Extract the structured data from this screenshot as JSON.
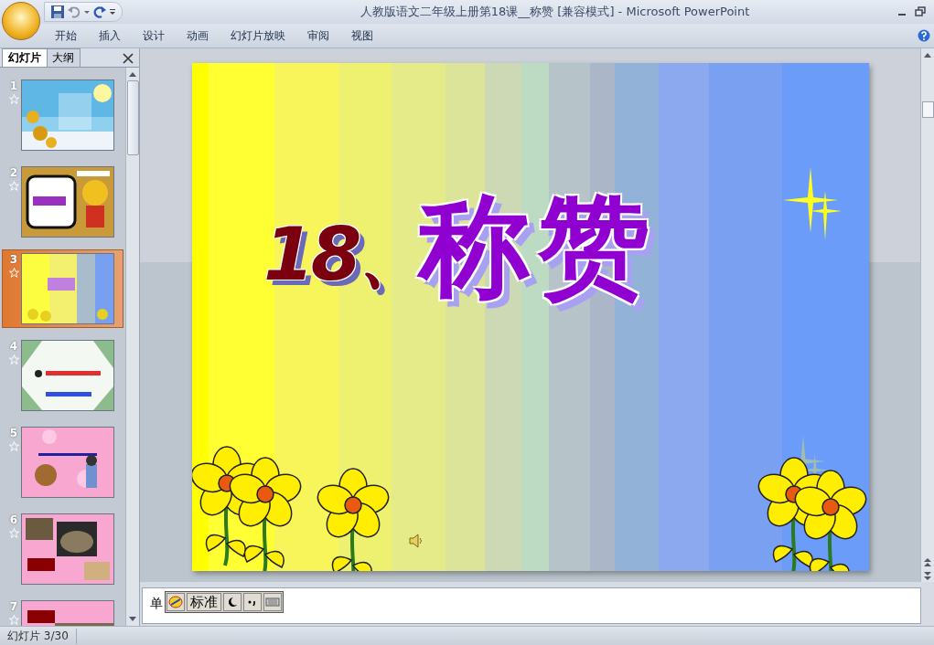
{
  "window": {
    "title": "人教版语文二年级上册第18课__称赞 [兼容模式] - Microsoft PowerPoint"
  },
  "ribbon_tabs": [
    {
      "label": "开始"
    },
    {
      "label": "插入"
    },
    {
      "label": "设计"
    },
    {
      "label": "动画"
    },
    {
      "label": "幻灯片放映"
    },
    {
      "label": "审阅"
    },
    {
      "label": "视图"
    }
  ],
  "panel_tabs": [
    {
      "label": "幻灯片",
      "selected": true
    },
    {
      "label": "大纲",
      "selected": false
    }
  ],
  "slides": [
    {
      "number": "1",
      "selected": false
    },
    {
      "number": "2",
      "selected": false
    },
    {
      "number": "3",
      "selected": true
    },
    {
      "number": "4",
      "selected": false
    },
    {
      "number": "5",
      "selected": false
    },
    {
      "number": "6",
      "selected": false
    },
    {
      "number": "7",
      "selected": false
    }
  ],
  "slide": {
    "number_text": "18、",
    "title": "称赞"
  },
  "notes": {
    "value": "单"
  },
  "ime_bar": {
    "mode": "标准"
  },
  "status_bar": {
    "slide_indicator": "幻灯片 3/30"
  }
}
